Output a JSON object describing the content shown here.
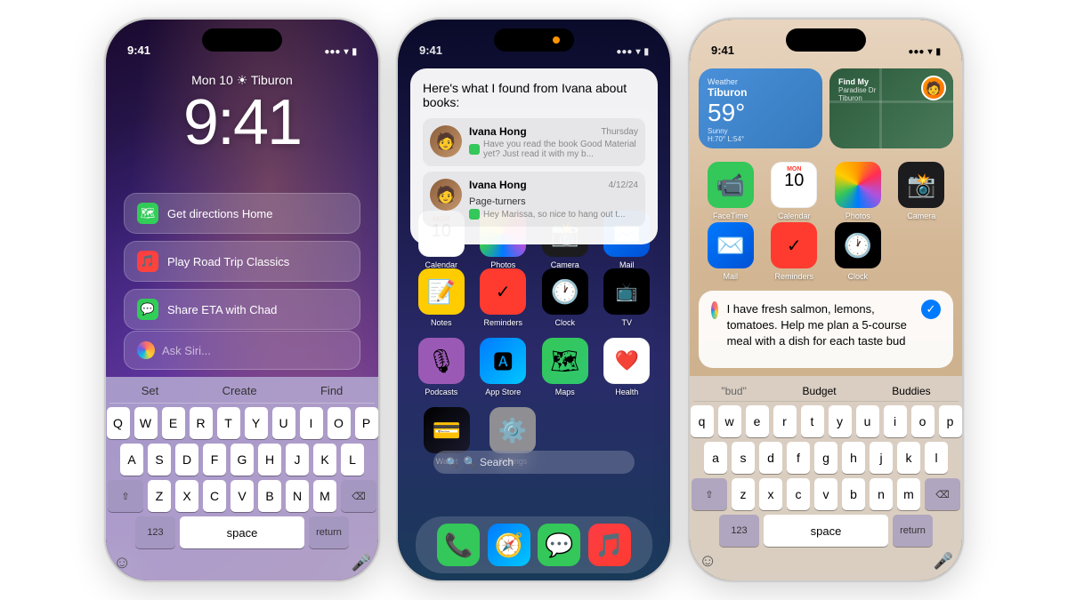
{
  "phones": {
    "phone1": {
      "status": {
        "time": "9:41",
        "network": "●●●▌",
        "wifi": "WiFi",
        "battery": "🔋"
      },
      "date": "Mon 10  ☀  Tiburon",
      "clock": "9:41",
      "suggestions": [
        {
          "icon": "maps",
          "label": "Get directions Home"
        },
        {
          "icon": "music",
          "label": "Play Road Trip Classics"
        },
        {
          "icon": "messages",
          "label": "Share ETA with Chad"
        }
      ],
      "siri_placeholder": "Ask Siri...",
      "keyboard": {
        "suggestions": [
          "Set",
          "Create",
          "Find"
        ],
        "rows": [
          [
            "Q",
            "W",
            "E",
            "R",
            "T",
            "Y",
            "U",
            "I",
            "O",
            "P"
          ],
          [
            "A",
            "S",
            "D",
            "F",
            "G",
            "H",
            "J",
            "K",
            "L"
          ],
          [
            "⇧",
            "Z",
            "X",
            "C",
            "V",
            "B",
            "N",
            "M",
            "⌫"
          ],
          [
            "123",
            "space",
            "return"
          ]
        ]
      }
    },
    "phone2": {
      "status": {
        "time": "9:41",
        "carrier": "●●●▌",
        "wifi": "WiFi",
        "battery": "🔋"
      },
      "siri_card": {
        "title": "Here's what I found from Ivana about books:",
        "messages": [
          {
            "sender": "Ivana Hong",
            "date": "Thursday",
            "subject": "",
            "preview": "Have you read the book Good Material yet? Just read it with my b..."
          },
          {
            "sender": "Ivana Hong",
            "date": "4/12/24",
            "subject": "Page-turners",
            "preview": "Hey Marissa, so nice to hang out t..."
          }
        ]
      },
      "top_apps": [
        "Calendar",
        "Photos",
        "Camera",
        "Mail"
      ],
      "apps_row1": [
        {
          "name": "Notes",
          "icon": "📝",
          "bg": "notes"
        },
        {
          "name": "Reminders",
          "icon": "✅",
          "bg": "reminders"
        },
        {
          "name": "Clock",
          "icon": "🕐",
          "bg": "clock"
        },
        {
          "name": "TV",
          "icon": "",
          "bg": "tv"
        }
      ],
      "apps_row2": [
        {
          "name": "Podcasts",
          "icon": "🎙",
          "bg": "podcasts"
        },
        {
          "name": "App Store",
          "icon": "🅰",
          "bg": "appstore"
        },
        {
          "name": "Maps",
          "icon": "🗺",
          "bg": "maps"
        },
        {
          "name": "Health",
          "icon": "❤️",
          "bg": "health"
        }
      ],
      "apps_row3": [
        {
          "name": "Wallet",
          "icon": "💳",
          "bg": "wallet"
        },
        {
          "name": "Settings",
          "icon": "⚙️",
          "bg": "settings"
        }
      ],
      "search_label": "🔍 Search",
      "dock": [
        "Phone",
        "Safari",
        "Messages",
        "Music"
      ]
    },
    "phone3": {
      "status": {
        "time": "9:41",
        "network": "●●●",
        "wifi": "WiFi",
        "battery": "🔋"
      },
      "widgets": {
        "weather": {
          "label": "Weather",
          "city": "Tiburon",
          "temp": "59°",
          "condition": "Sunny",
          "hi_lo": "H:70° L:54°"
        },
        "findmy": {
          "label": "Find My",
          "sublabel": "Paradise Dr\nTiburon"
        }
      },
      "apps_row1": [
        {
          "name": "FaceTime",
          "icon": "📹",
          "bg": "facetime"
        },
        {
          "name": "Calendar",
          "icon": "📅",
          "bg": "calendar"
        },
        {
          "name": "Photos",
          "icon": "📷",
          "bg": "photos"
        },
        {
          "name": "Camera",
          "icon": "📸",
          "bg": "camera"
        }
      ],
      "apps_row2": [
        {
          "name": "Mail",
          "icon": "✉️",
          "bg": "mail"
        },
        {
          "name": "Reminders",
          "icon": "✅",
          "bg": "reminders"
        },
        {
          "name": "Clock",
          "icon": "🕐",
          "bg": "clock"
        }
      ],
      "siri_input": {
        "text": "I have fresh salmon, lemons, tomatoes. Help me plan a 5-course meal with a dish for each taste bud",
        "predictions": [
          "\"bud\"",
          "Budget",
          "Buddies"
        ]
      },
      "keyboard": {
        "rows": [
          [
            "q",
            "w",
            "e",
            "r",
            "t",
            "y",
            "u",
            "i",
            "o",
            "p"
          ],
          [
            "a",
            "s",
            "d",
            "f",
            "g",
            "h",
            "j",
            "k",
            "l"
          ],
          [
            "⇧",
            "z",
            "x",
            "c",
            "v",
            "b",
            "n",
            "m",
            "⌫"
          ],
          [
            "123",
            "space",
            "return"
          ]
        ]
      }
    }
  }
}
